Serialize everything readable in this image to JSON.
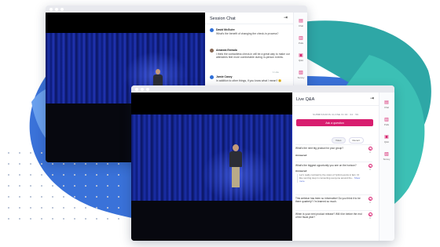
{
  "back_window": {
    "panel_title": "Session Chat",
    "messages": [
      {
        "name": "David McGuire",
        "text": "What's the benefit of changing the check-in process?"
      },
      {
        "name": "Amanda Estrada",
        "text": "I think the contactless check-in will be a great way to make our attendees feel more comfortable during in-person events."
      },
      {
        "name": "Jamie Casey",
        "text": "In addition to other things, if you know what I mean? 😉",
        "reactions": "1 Like"
      }
    ],
    "sidebar": [
      "Chat",
      "Polls",
      "Q&A",
      "Survey"
    ]
  },
  "front_window": {
    "panel_title": "Live Q&A",
    "submissions_notice": "SUBMISSIONS CLOSE IN 00 : 04 : 59",
    "ask_button": "Ask a question",
    "filters": [
      "Votes",
      "Recent"
    ],
    "questions": [
      {
        "text": "What's the next big product for your group?",
        "votes": "0",
        "answered_label": "Answered"
      },
      {
        "text": "What's the biggest opportunity you see on the horizon?",
        "votes": "0",
        "answered_label": "Answered",
        "answer": "Let's really contrast by the vision of hybrid events in fact. I'd like next big step in connecting everyone around the...",
        "more": "Show more"
      },
      {
        "text": "This webinar has been so informative! Do you think it to be there quarterly? I'm learned so much.",
        "votes": "0"
      },
      {
        "text": "When is your next product release? Will it be before the end of the fiscal year?",
        "votes": "0"
      }
    ],
    "sidebar": [
      "Chat",
      "Polls",
      "Q&A",
      "Survey"
    ]
  },
  "colors": {
    "accent": "#d81e6f",
    "curtain": "#1b2fa8"
  }
}
